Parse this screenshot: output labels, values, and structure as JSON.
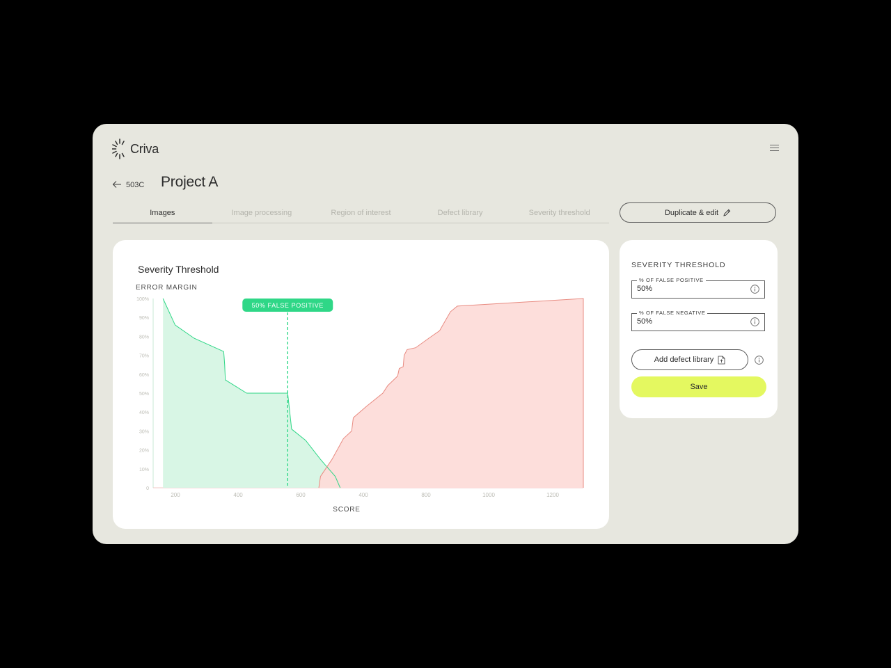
{
  "app": {
    "brand": "Criva",
    "logo_icon": "sunburst-logo-icon",
    "menu_icon": "hamburger-menu-icon"
  },
  "header": {
    "back_code": "503C",
    "project_title": "Project A"
  },
  "tabs": [
    {
      "label": "Images",
      "active": true
    },
    {
      "label": "Image processing",
      "active": false
    },
    {
      "label": "Region of interest",
      "active": false
    },
    {
      "label": "Defect library",
      "active": false
    },
    {
      "label": "Severity threshold",
      "active": false
    }
  ],
  "actions": {
    "duplicate_label": "Duplicate & edit",
    "duplicate_icon": "pencil-icon"
  },
  "side_panel": {
    "title": "SEVERITY THRESHOLD",
    "false_positive": {
      "label": "% OF FALSE POSITIVE",
      "value": "50%"
    },
    "false_negative": {
      "label": "% OF FALSE NEGATIVE",
      "value": "50%"
    },
    "add_library_label": "Add defect library",
    "add_library_icon": "file-upload-icon",
    "info_icon": "info-circle-icon",
    "save_label": "Save"
  },
  "colors": {
    "accent_lime": "#e4f860",
    "false_positive_green": "#2fd787",
    "false_negative_red": "#e88a80",
    "green_fill": "#d6f6e4",
    "red_fill": "#fddcd9"
  },
  "chart_data": {
    "type": "area",
    "title": "Severity Threshold",
    "ylabel": "ERROR MARGIN",
    "xlabel": "SCORE",
    "x_tick_labels": [
      "200",
      "400",
      "600",
      "400",
      "800",
      "1000",
      "1200"
    ],
    "y_tick_labels": [
      "0",
      "10%",
      "20%",
      "30%",
      "40%",
      "50%",
      "60%",
      "70%",
      "80%",
      "90%",
      "100%"
    ],
    "ylim": [
      0,
      100
    ],
    "threshold": {
      "label": "50% FALSE POSITIVE",
      "x": 440
    },
    "series": [
      {
        "color": "#2fd787",
        "fill": "#d6f6e4",
        "points": [
          [
            60,
            100
          ],
          [
            97,
            86
          ],
          [
            155,
            79
          ],
          [
            245,
            72
          ],
          [
            248,
            65
          ],
          [
            250,
            57
          ],
          [
            315,
            50
          ],
          [
            440,
            50
          ],
          [
            452,
            31
          ],
          [
            495,
            25
          ],
          [
            540,
            15
          ],
          [
            585,
            6
          ],
          [
            600,
            0
          ]
        ]
      },
      {
        "color": "#e88a80",
        "fill": "#fddcd9",
        "points": [
          [
            535,
            0
          ],
          [
            540,
            6
          ],
          [
            575,
            15
          ],
          [
            610,
            26
          ],
          [
            635,
            30
          ],
          [
            640,
            37
          ],
          [
            680,
            43
          ],
          [
            730,
            50
          ],
          [
            745,
            54
          ],
          [
            775,
            59
          ],
          [
            780,
            63
          ],
          [
            792,
            64
          ],
          [
            795,
            70
          ],
          [
            804,
            73
          ],
          [
            830,
            74
          ],
          [
            870,
            79
          ],
          [
            903,
            83
          ],
          [
            936,
            93
          ],
          [
            957,
            96
          ],
          [
            1341,
            100
          ],
          [
            1341,
            0
          ]
        ]
      }
    ]
  }
}
